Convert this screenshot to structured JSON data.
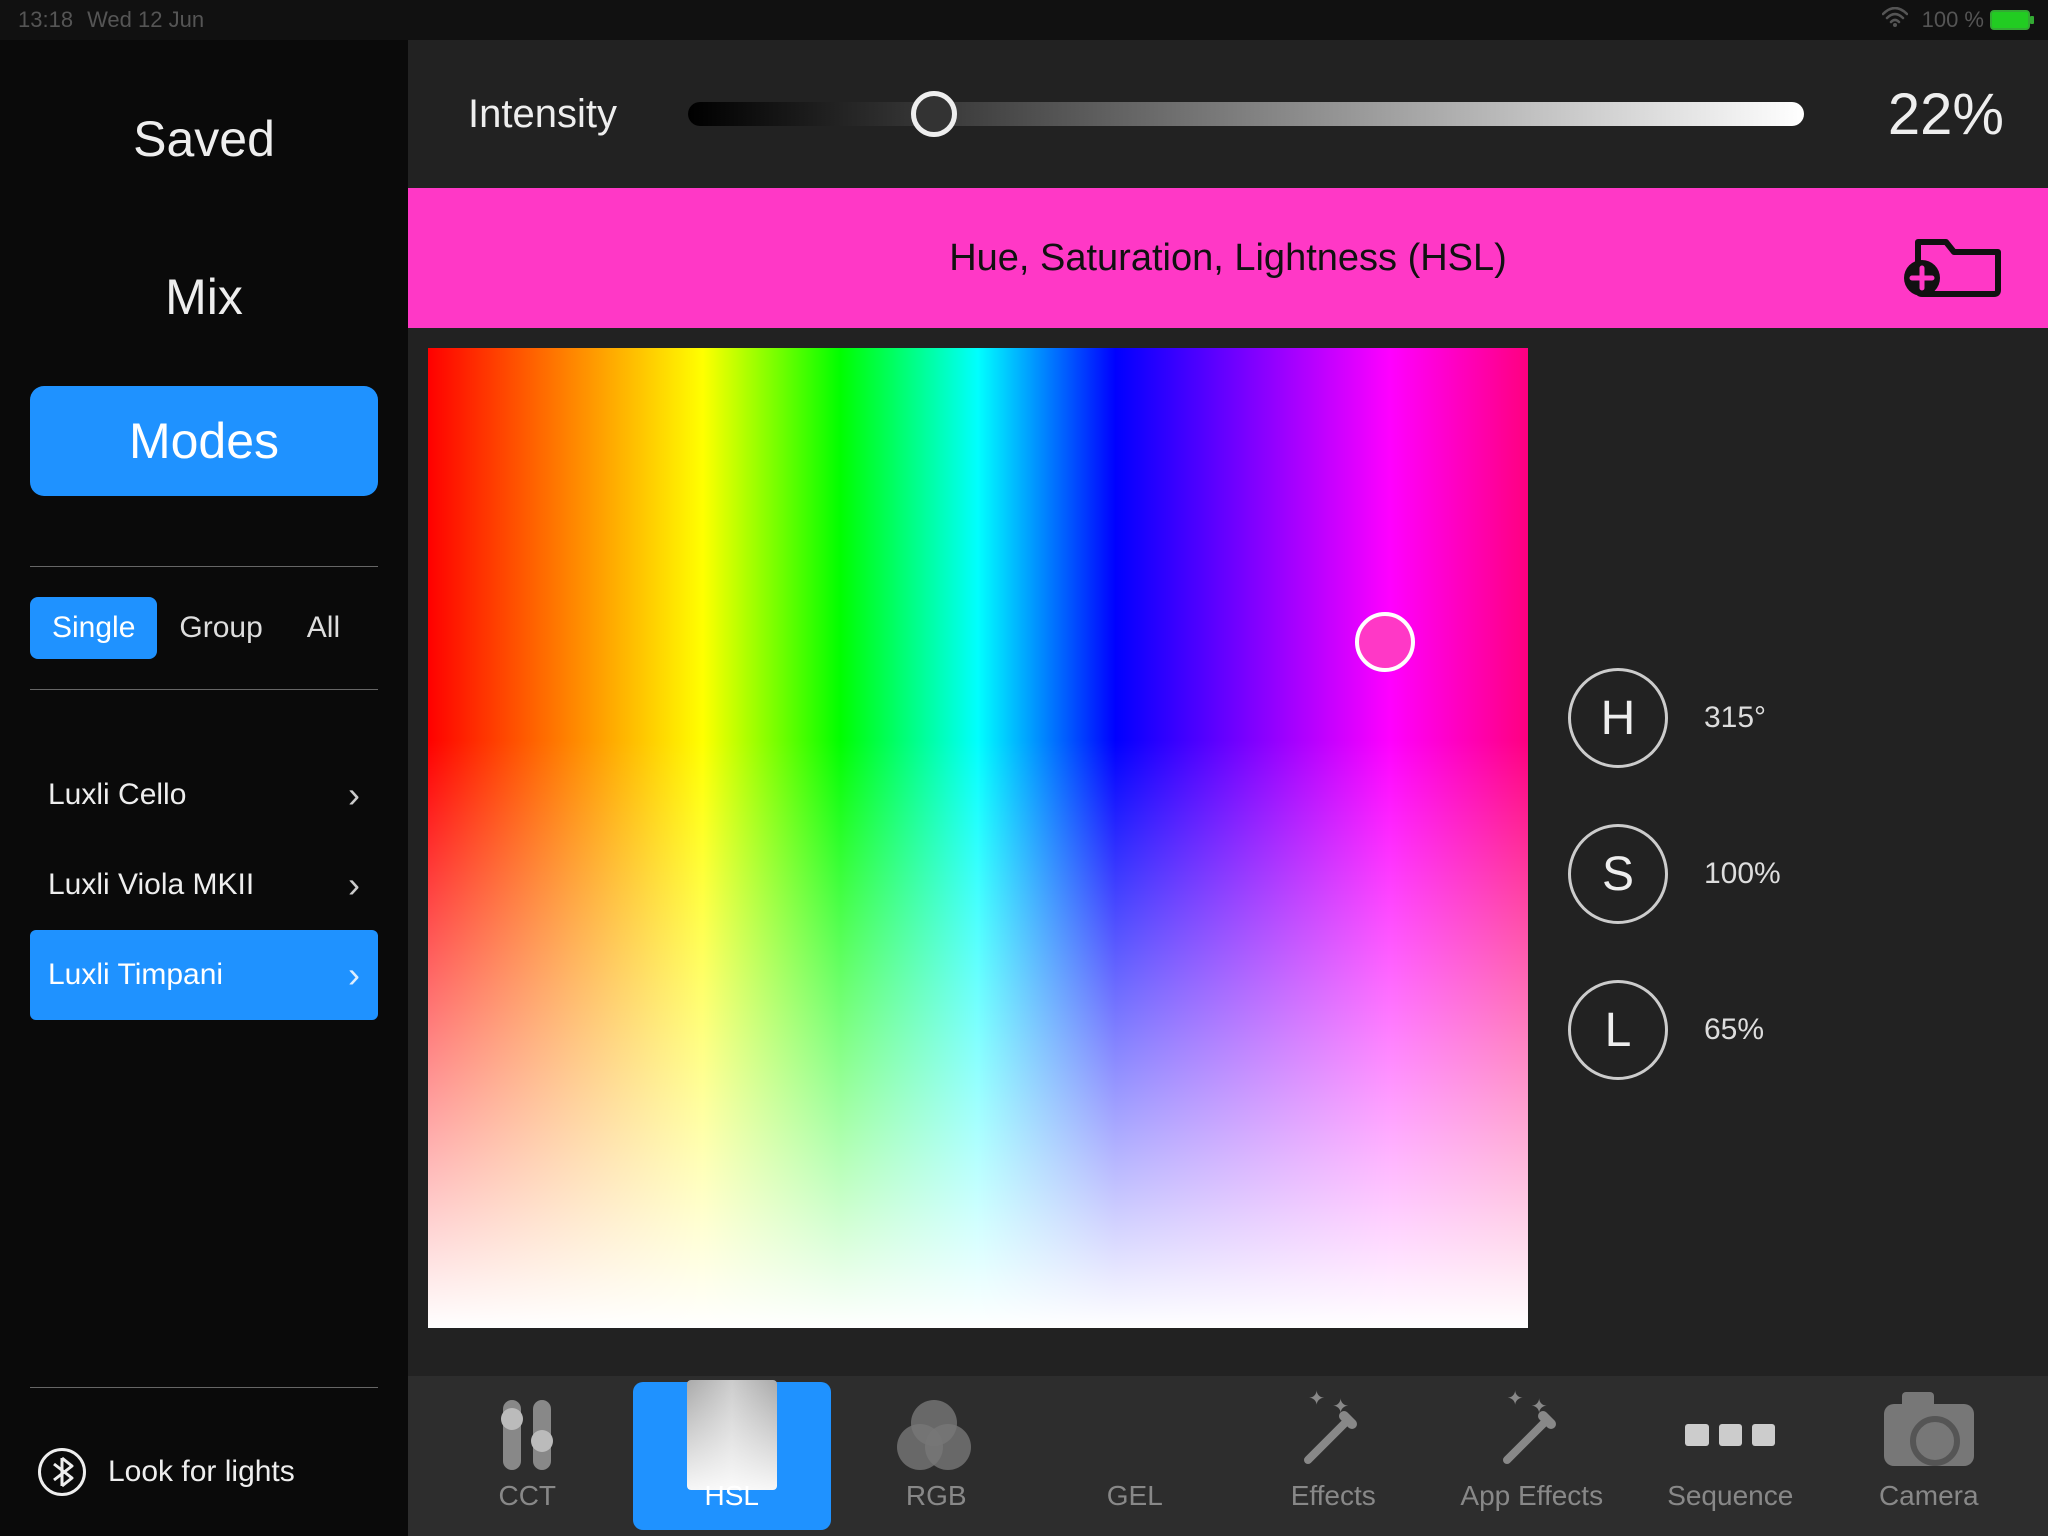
{
  "statusbar": {
    "time": "13:18",
    "date": "Wed 12 Jun",
    "battery": "100 %"
  },
  "sidebar": {
    "nav": [
      "Saved",
      "Mix",
      "Modes"
    ],
    "active_nav": 2,
    "segments": [
      "Single",
      "Group",
      "All"
    ],
    "active_segment": 0,
    "devices": [
      {
        "name": "Luxli Cello",
        "active": false
      },
      {
        "name": "Luxli Viola MKII",
        "active": false
      },
      {
        "name": "Luxli Timpani",
        "active": true
      }
    ],
    "look_for_lights": "Look for lights"
  },
  "intensity": {
    "label": "Intensity",
    "value": "22%",
    "percent": 22
  },
  "mode_banner": {
    "title": "Hue, Saturation, Lightness (HSL)",
    "color": "#ff38c6"
  },
  "hsl": {
    "H": {
      "label": "H",
      "value": "315°"
    },
    "S": {
      "label": "S",
      "value": "100%"
    },
    "L": {
      "label": "L",
      "value": "65%"
    },
    "picker": {
      "x_pct": 87,
      "y_pct": 30
    }
  },
  "tabs": [
    {
      "id": "cct",
      "label": "CCT"
    },
    {
      "id": "hsl",
      "label": "HSL"
    },
    {
      "id": "rgb",
      "label": "RGB"
    },
    {
      "id": "gel",
      "label": "GEL"
    },
    {
      "id": "effects",
      "label": "Effects"
    },
    {
      "id": "appeffects",
      "label": "App Effects"
    },
    {
      "id": "sequence",
      "label": "Sequence"
    },
    {
      "id": "camera",
      "label": "Camera"
    }
  ],
  "active_tab": 1
}
